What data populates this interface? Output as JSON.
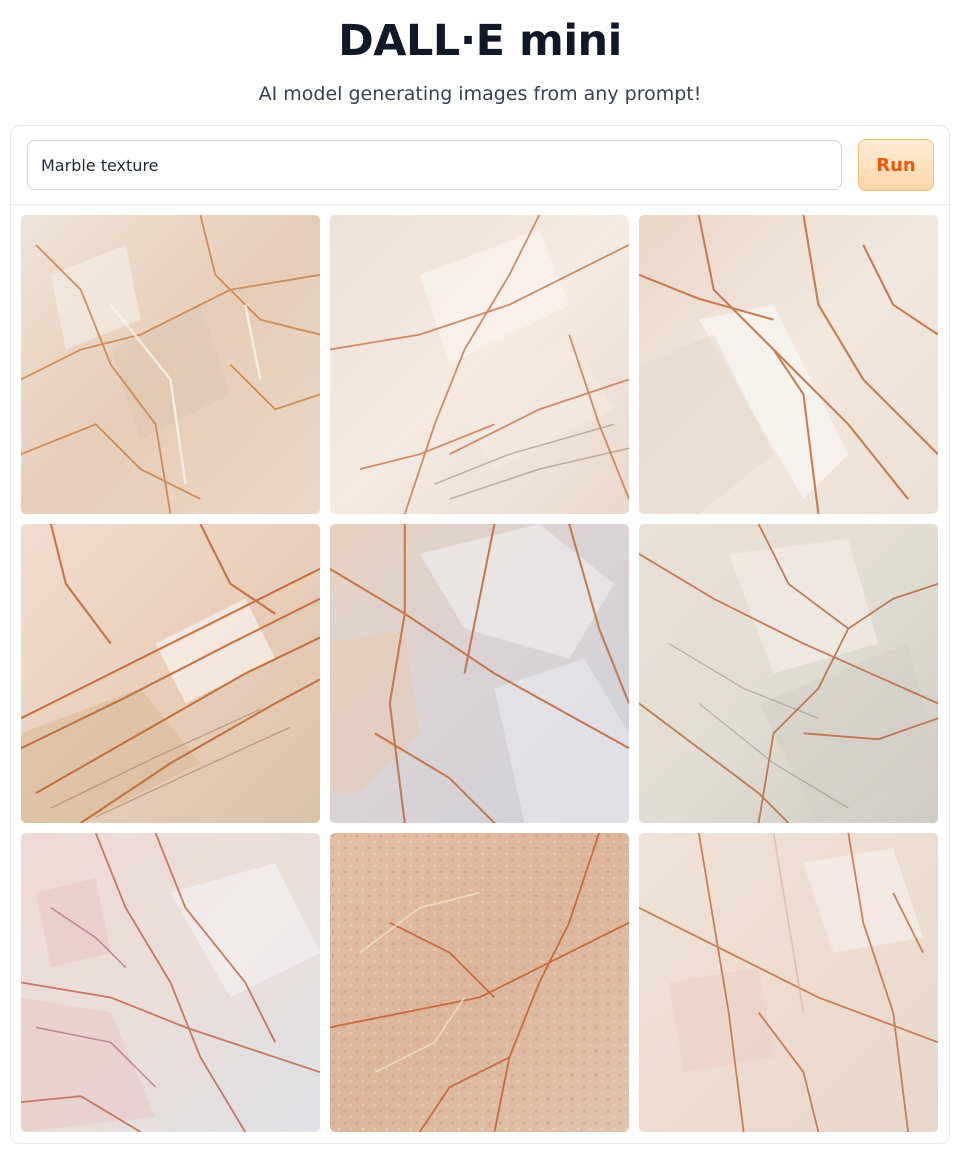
{
  "header": {
    "title": "DALL·E mini",
    "subtitle": "AI model generating images from any prompt!"
  },
  "prompt": {
    "value": "Marble texture"
  },
  "run_button": {
    "label": "Run"
  },
  "colors": {
    "accent_text": "#ea580c",
    "accent_bg": "#fed7aa",
    "border": "#e5e7eb"
  },
  "gallery": {
    "image_count": 9,
    "subject": "marble-texture-image"
  }
}
